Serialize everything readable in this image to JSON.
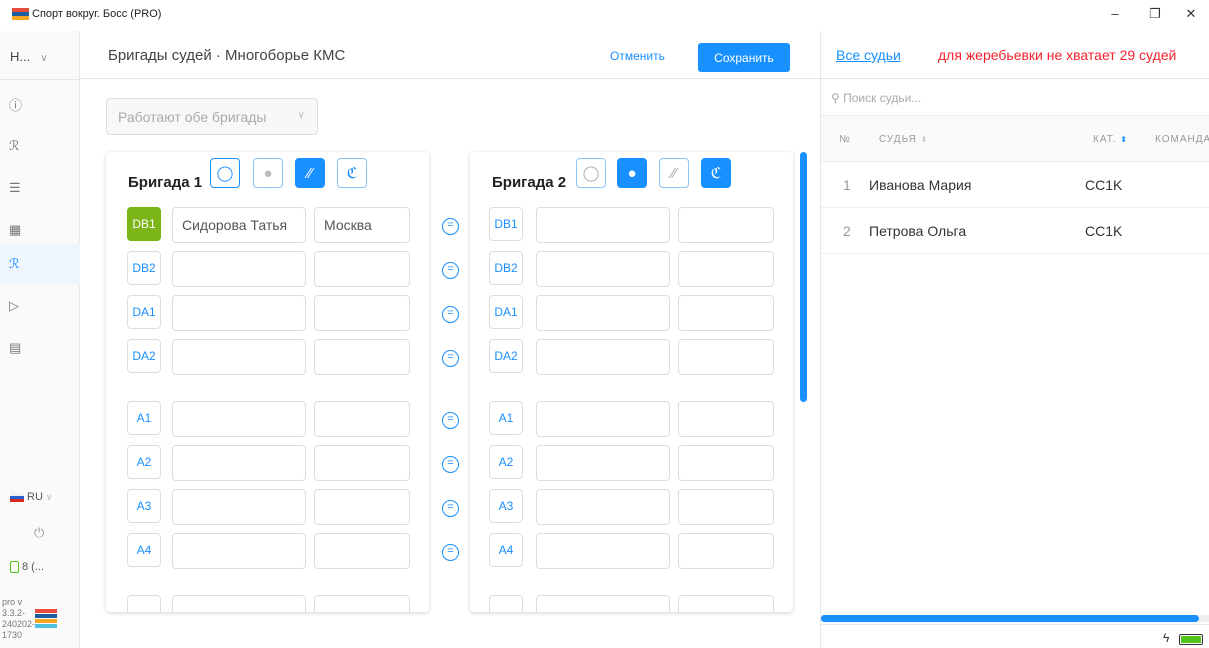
{
  "window": {
    "title": "Спорт вокруг. Босс (PRO)",
    "minimize": "–",
    "restore": "❐",
    "close": "✕"
  },
  "sidebar": {
    "select": "Н...",
    "items": [
      {
        "icon": "info-icon",
        "glyph": "ⓘ"
      },
      {
        "icon": "judges-icon",
        "glyph": "ℛ"
      },
      {
        "icon": "list-icon",
        "glyph": "☰"
      },
      {
        "icon": "calendar-icon",
        "glyph": "▦"
      },
      {
        "icon": "brigades-icon",
        "glyph": "ℛ"
      },
      {
        "icon": "play-icon",
        "glyph": "▷"
      },
      {
        "icon": "document-icon",
        "glyph": "▤"
      }
    ],
    "language": "RU",
    "power": "⏻",
    "device": "8 (...",
    "version": "pro v 3.3.2-240202-1730"
  },
  "header": {
    "title": "Бригады судей  ·  Многоборье КМС",
    "cancel": "Отменить",
    "save": "Сохранить"
  },
  "mode": {
    "value": "Работают обе бригады"
  },
  "brigades": [
    {
      "title": "Бригада 1",
      "rows": [
        {
          "role": "DB1",
          "name": "Сидорова Татья",
          "city": "Москва",
          "active": true
        },
        {
          "role": "DB2",
          "name": "",
          "city": ""
        },
        {
          "role": "DA1",
          "name": "",
          "city": ""
        },
        {
          "role": "DA2",
          "name": "",
          "city": ""
        },
        {
          "role": "A1",
          "name": "",
          "city": ""
        },
        {
          "role": "A2",
          "name": "",
          "city": ""
        },
        {
          "role": "A3",
          "name": "",
          "city": ""
        },
        {
          "role": "A4",
          "name": "",
          "city": ""
        }
      ]
    },
    {
      "title": "Бригада 2",
      "rows": [
        {
          "role": "DB1",
          "name": "",
          "city": ""
        },
        {
          "role": "DB2",
          "name": "",
          "city": ""
        },
        {
          "role": "DA1",
          "name": "",
          "city": ""
        },
        {
          "role": "DA2",
          "name": "",
          "city": ""
        },
        {
          "role": "A1",
          "name": "",
          "city": ""
        },
        {
          "role": "A2",
          "name": "",
          "city": ""
        },
        {
          "role": "A3",
          "name": "",
          "city": ""
        },
        {
          "role": "A4",
          "name": "",
          "city": ""
        }
      ]
    }
  ],
  "judges_panel": {
    "all_judges": "Все судьи",
    "warning": "для жеребьевки не хватает 29 судей",
    "search_placeholder": "Поиск судьи...",
    "columns": [
      "№",
      "СУДЬЯ",
      "КАТ.",
      "КОМАНДА"
    ],
    "rows": [
      {
        "num": "1",
        "name": "Иванова Мария",
        "cat": "CC1K"
      },
      {
        "num": "2",
        "name": "Петрова Ольга",
        "cat": "CC1K"
      }
    ]
  }
}
